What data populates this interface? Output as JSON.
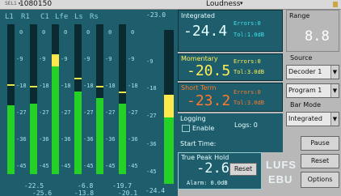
{
  "topbar": {
    "select_hint": "SEL1 ▾",
    "id": "1080150",
    "title": "Loudness"
  },
  "channels": [
    {
      "name": "L1",
      "level": 0.46,
      "yellow": 0,
      "peak": 0.59
    },
    {
      "name": "R1",
      "level": 0.47,
      "yellow": 0,
      "peak": 0.58
    },
    {
      "name": "C1",
      "level": 0.72,
      "yellow": 0.07,
      "peak": 0.79
    },
    {
      "name": "Lfe",
      "level": 0.55,
      "yellow": 0,
      "peak": 0.63
    },
    {
      "name": "Ls",
      "level": 0.51,
      "yellow": 0,
      "peak": 0.58
    },
    {
      "name": "Rs",
      "level": 0.47,
      "yellow": 0,
      "peak": 0.54
    }
  ],
  "scale_ticks": [
    "0",
    "-9",
    "-18",
    "-27",
    "-36",
    "-45"
  ],
  "readouts_top": [
    "-22.5",
    "-6.8",
    "-19.7"
  ],
  "readouts_bottom": [
    "-25.6",
    "-13.8",
    "-20.1"
  ],
  "main_meter": {
    "top_value": "-23.0",
    "bottom_value": "-24.4",
    "level": 0.43,
    "yellow": 0.15,
    "ticks": [
      "-9",
      "-18",
      "-27",
      "-36",
      "-45"
    ]
  },
  "integrated": {
    "label": "Integrated",
    "value": "-24.4",
    "errors": "Errors:0",
    "tol": "Tol:1.0dB"
  },
  "momentary": {
    "label": "Momentary",
    "value": "-20.5",
    "errors": "Errors:0",
    "tol": "Tol:3.0dB"
  },
  "short_term": {
    "label": "Short Term",
    "value": "-23.2",
    "errors": "Errors:0",
    "tol": "Tol:3.0dB"
  },
  "logging": {
    "label": "Logging",
    "enable_label": "Enable",
    "logs_label": "Logs: 0",
    "start_label": "Start Time:"
  },
  "true_peak": {
    "label": "True Peak Hold",
    "value": "-2.6",
    "reset": "Reset",
    "alarm": "Alarm: 0.0dB"
  },
  "range": {
    "label": "Range",
    "value": "8.8"
  },
  "source": {
    "label": "Source",
    "decoder": "Decoder 1",
    "program": "Program 1"
  },
  "bar_mode": {
    "label": "Bar Mode",
    "value": "Integrated"
  },
  "buttons": {
    "pause": "Pause",
    "reset": "Reset",
    "options": "Options"
  },
  "logos": {
    "lufs": "LUFS",
    "ebu": "EBU"
  },
  "colors": {
    "meter_bg": "#1e5d6c",
    "green": "#24d124",
    "yellow": "#ffe94a",
    "integrated_text": "#e8ffff",
    "momentary_text": "#ffee55",
    "short_term_text": "#ff7a2a",
    "status_text": "#3fe3e8"
  }
}
